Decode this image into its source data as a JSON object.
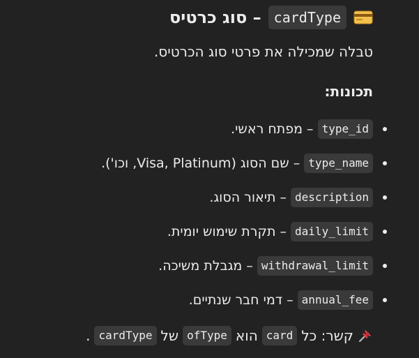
{
  "heading": {
    "code": "cardType",
    "text": "– סוג כרטיס",
    "icon": "credit-card-icon"
  },
  "description": "טבלה שמכילה את פרטי סוג הכרטיס.",
  "properties_title": "תכונות:",
  "properties": [
    {
      "code": "type_id",
      "text": "– מפתח ראשי."
    },
    {
      "code": "type_name",
      "text": "– שם הסוג (Visa, Platinum, וכו')."
    },
    {
      "code": "description",
      "text": "– תיאור הסוג."
    },
    {
      "code": "daily_limit",
      "text": "– תקרת שימוש יומית."
    },
    {
      "code": "withdrawal_limit",
      "text": "– מגבלת משיכה."
    },
    {
      "code": "annual_fee",
      "text": "– דמי חבר שנתיים."
    }
  ],
  "relation": {
    "icon": "pushpin-icon",
    "prefix": "קשר: כל",
    "code1": "card",
    "word1": "הוא",
    "code2": "ofType",
    "word2": "של",
    "code3": "cardType",
    "suffix": "."
  },
  "colors": {
    "background": "#222222",
    "text": "#ececec",
    "code_background": "#3a3a3a"
  }
}
